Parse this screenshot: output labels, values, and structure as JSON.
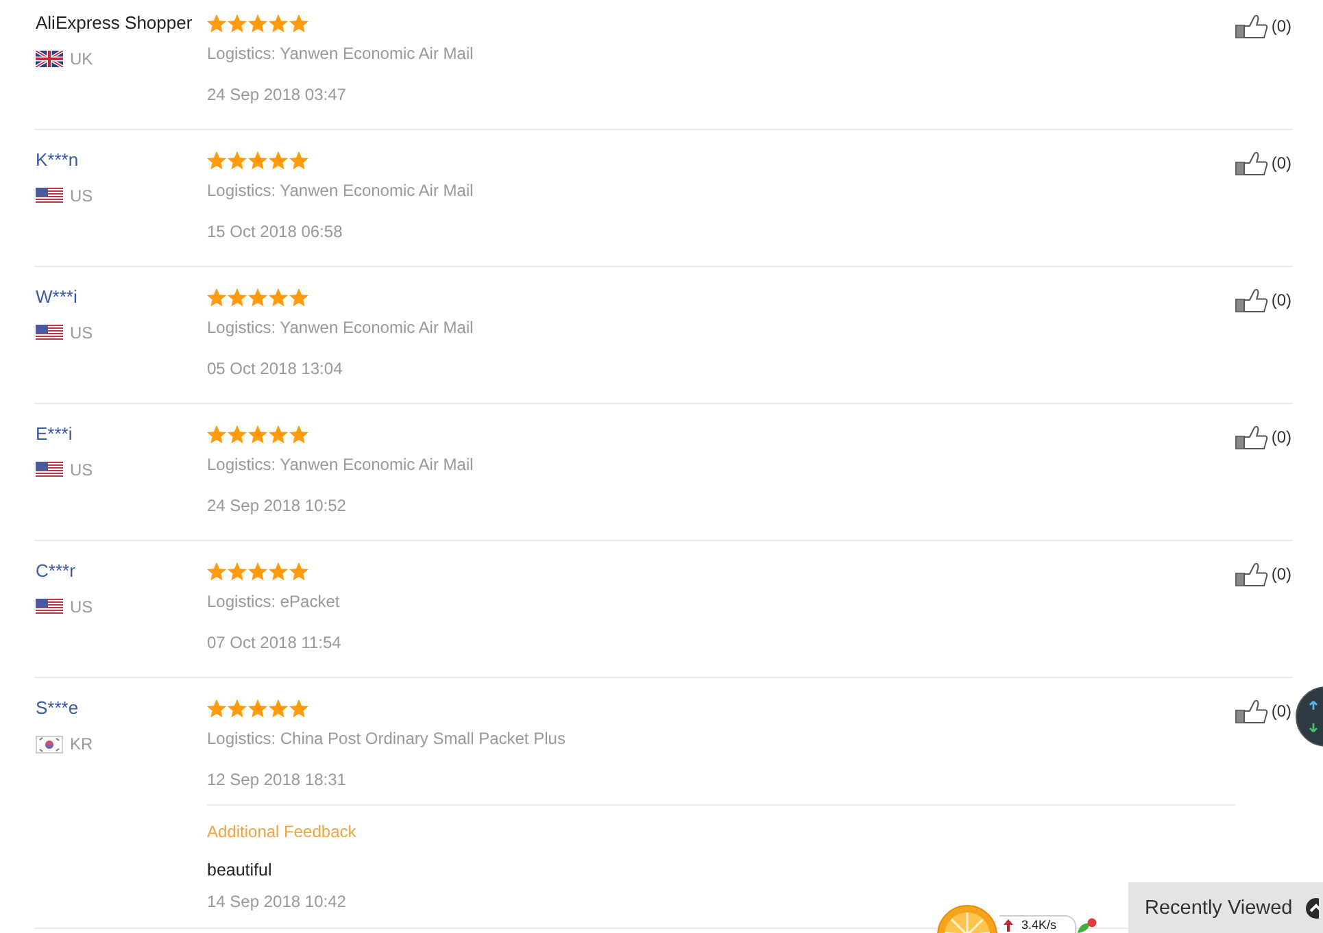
{
  "reviews": [
    {
      "name": "AliExpress Shopper",
      "is_link": false,
      "country": {
        "kind": "gb",
        "code": "UK"
      },
      "stars": 5,
      "logistics": "Logistics: Yanwen Economic Air Mail",
      "date": "24 Sep 2018 03:47",
      "likes": "(0)"
    },
    {
      "name": "K***n",
      "is_link": true,
      "country": {
        "kind": "us",
        "code": "US"
      },
      "stars": 5,
      "logistics": "Logistics: Yanwen Economic Air Mail",
      "date": "15 Oct 2018 06:58",
      "likes": "(0)"
    },
    {
      "name": "W***i",
      "is_link": true,
      "country": {
        "kind": "us",
        "code": "US"
      },
      "stars": 5,
      "logistics": "Logistics: Yanwen Economic Air Mail",
      "date": "05 Oct 2018 13:04",
      "likes": "(0)"
    },
    {
      "name": "E***i",
      "is_link": true,
      "country": {
        "kind": "us",
        "code": "US"
      },
      "stars": 5,
      "logistics": "Logistics: Yanwen Economic Air Mail",
      "date": "24 Sep 2018 10:52",
      "likes": "(0)"
    },
    {
      "name": "C***r",
      "is_link": true,
      "country": {
        "kind": "us",
        "code": "US"
      },
      "stars": 5,
      "logistics": "Logistics: ePacket",
      "date": "07 Oct 2018 11:54",
      "likes": "(0)"
    },
    {
      "name": "S***e",
      "is_link": true,
      "country": {
        "kind": "kr",
        "code": "KR"
      },
      "stars": 5,
      "logistics": "Logistics: China Post Ordinary Small Packet Plus",
      "date": "12 Sep 2018 18:31",
      "likes": "(0)",
      "additional_feedback": {
        "heading": "Additional Feedback",
        "text": "beautiful",
        "date": "14 Sep 2018 10:42"
      }
    }
  ],
  "speed_monitor": {
    "upload_speed": "3.4K/s"
  },
  "recently_viewed_bar": {
    "label": "Recently Viewed"
  }
}
